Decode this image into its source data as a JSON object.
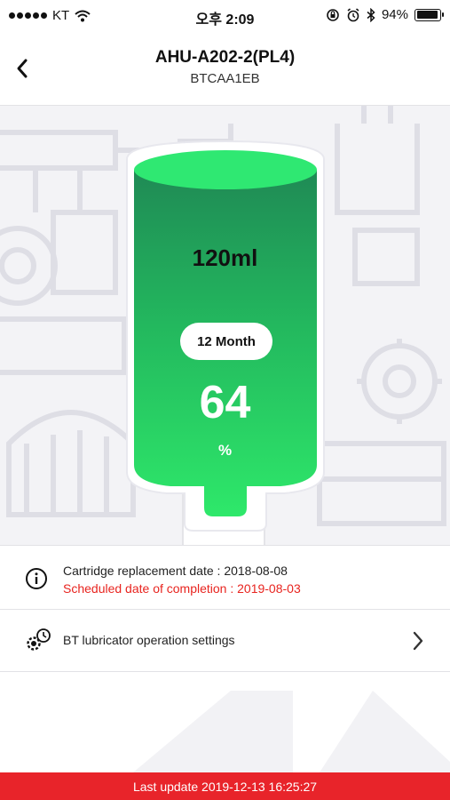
{
  "status_bar": {
    "carrier": "KT",
    "time": "오후 2:09",
    "battery_percent": "94%",
    "battery_level": 0.94,
    "icons": [
      "signal-dots",
      "wifi-icon",
      "lock-rotation-icon",
      "alarm-icon",
      "bluetooth-icon",
      "battery-icon"
    ]
  },
  "header": {
    "title": "AHU-A202-2(PL4)",
    "subtitle": "BTCAA1EB",
    "back_icon": "chevron-left-icon"
  },
  "gauge": {
    "volume": "120ml",
    "period": "12 Month",
    "percent": "64",
    "percent_sign": "%",
    "level": 0.64,
    "colors": {
      "top": "#1e9e5e",
      "bottom": "#2ee86a",
      "surface": "#2ee874"
    }
  },
  "info": {
    "icon": "info-icon",
    "replacement_date": "Cartridge replacement date : 2018-08-08",
    "completion_date": "Scheduled date of completion : 2019-08-03",
    "completion_color": "#e8241f"
  },
  "settings": {
    "icon": "gear-clock-icon",
    "label": "BT lubricator operation settings",
    "chevron": "chevron-right-icon"
  },
  "footer": {
    "last_update": "Last update 2019-12-13 16:25:27",
    "color": "#e8242a"
  }
}
